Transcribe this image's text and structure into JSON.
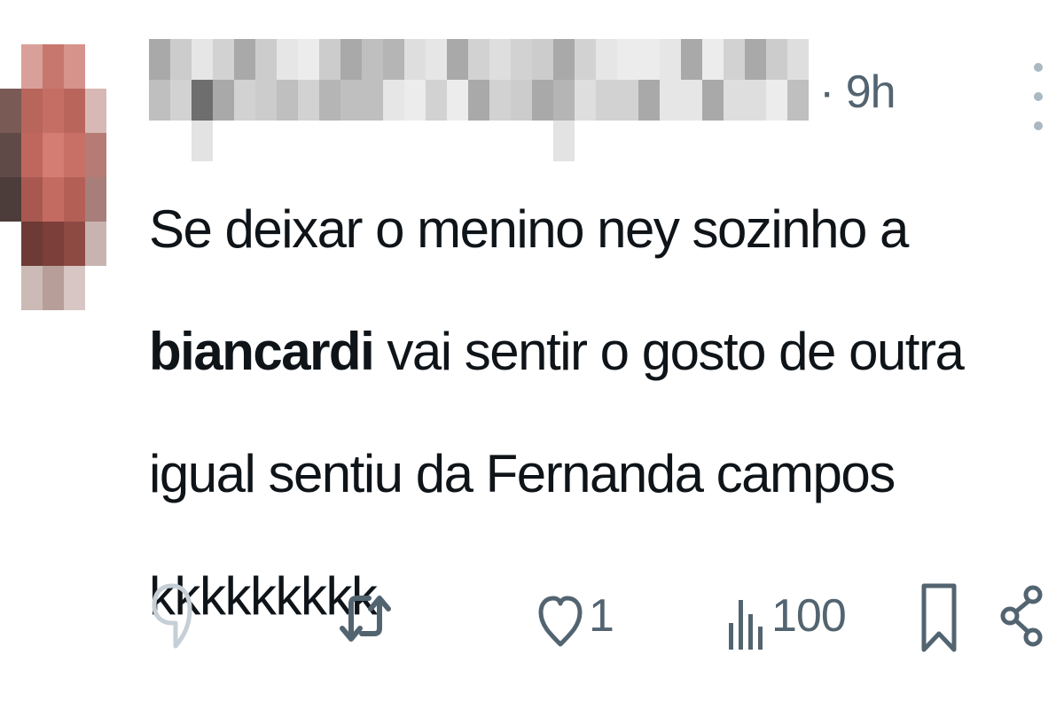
{
  "post": {
    "timestamp": "· 9h",
    "text_parts": {
      "part1": "Se deixar o menino ney sozinho a ",
      "bold": "biancardi",
      "part2": " vai sentir o gosto de outra igual sentiu da Fernanda campos kkkkkkkkk"
    }
  },
  "actions": {
    "reply_count": "",
    "repost_count": "",
    "like_count": "1",
    "views_count": "100"
  },
  "icons": {
    "reply": "reply-icon",
    "repost": "repost-icon",
    "like": "heart-icon",
    "views": "views-icon",
    "bookmark": "bookmark-icon",
    "share": "share-icon",
    "more": "more-options-icon"
  },
  "colors": {
    "icon_gray": "#536471",
    "text": "#0f1419"
  }
}
